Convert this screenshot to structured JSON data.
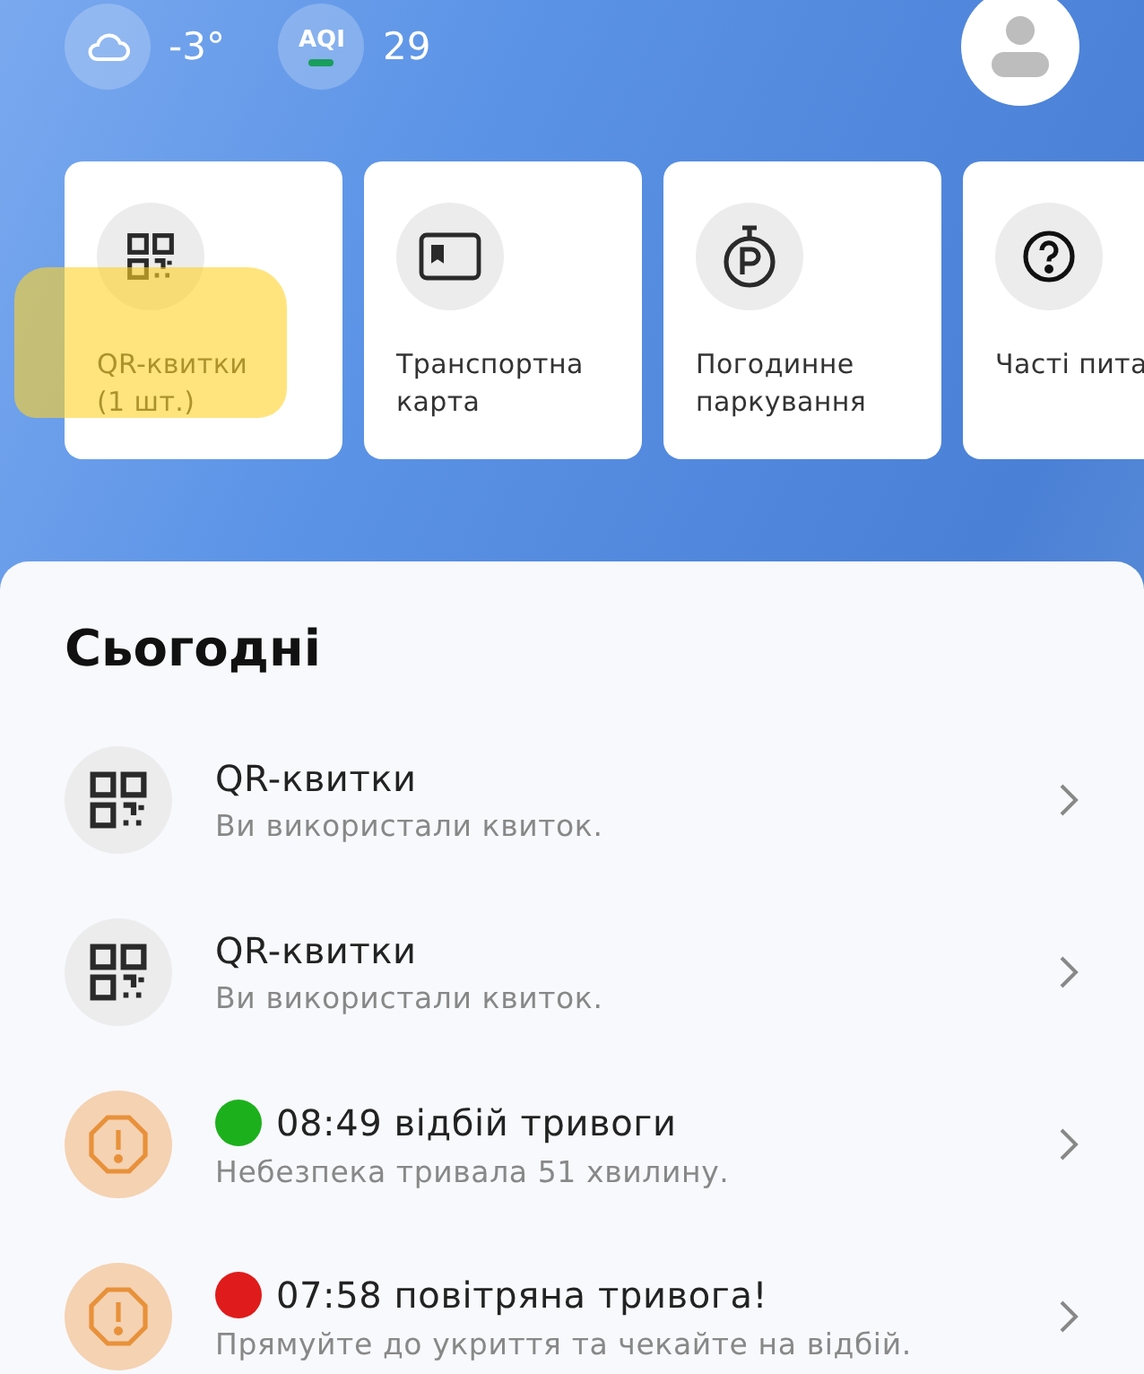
{
  "weather": {
    "temperature": "-3°"
  },
  "aqi": {
    "label": "AQI",
    "value": "29",
    "color": "#1a9e5c"
  },
  "shortcuts": [
    {
      "kind": "qr",
      "label": "QR-квитки\n(1 шт.)",
      "highlighted": true
    },
    {
      "kind": "card",
      "label": "Транспортна\nкарта",
      "highlighted": false
    },
    {
      "kind": "parking",
      "label": "Погодинне\nпаркування",
      "highlighted": false
    },
    {
      "kind": "help",
      "label": "Часті пита",
      "highlighted": false
    }
  ],
  "today": {
    "title": "Сьогодні",
    "items": [
      {
        "kind": "qr",
        "title": "QR-квитки",
        "subtitle": "Ви використали квиток."
      },
      {
        "kind": "qr",
        "title": "QR-квитки",
        "subtitle": "Ви використали квиток."
      },
      {
        "kind": "alert",
        "color": "#1db01d",
        "title": "08:49 відбій тривоги",
        "subtitle": "Небезпека тривала 51 хвилину."
      },
      {
        "kind": "alert",
        "color": "#e01b1b",
        "title": "07:58 повітряна тривога!",
        "subtitle": "Прямуйте до укриття та чекайте на відбій."
      }
    ]
  }
}
